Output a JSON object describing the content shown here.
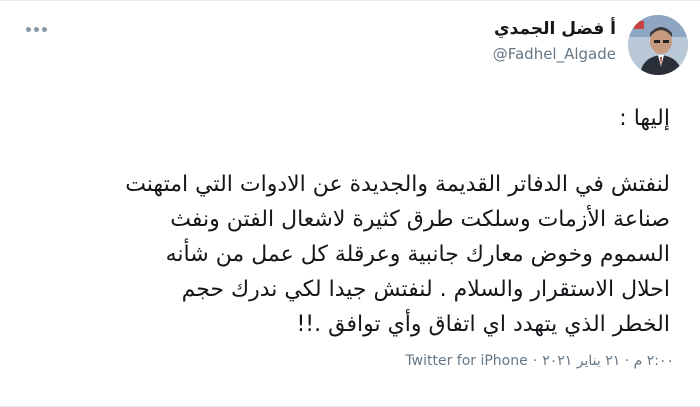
{
  "tweet": {
    "display_name": "أ فضل الجمدي",
    "handle": "@Fadhel_Algade",
    "avatar_icon": "profile-photo",
    "more_icon": "more-options-icon",
    "greeting": "إليها :",
    "lines": [
      "لنفتش في الدفاتر القديمة والجديدة عن الادوات التي امتهنت",
      "صناعة الأزمات وسلكت طرق كثيرة لاشعال الفتن ونفث",
      "السموم وخوض معارك جانبية  وعرقلة كل عمل من شأنه",
      "احلال الاستقرار والسلام . لنفتش جيدا لكي ندرك حجم",
      "الخطر الذي يتهدد اي اتفاق وأي توافق .!!"
    ],
    "timestamp": "٢:٠٠ م · ٢١ يناير ٢٠٢١",
    "separator": "·",
    "source": "Twitter for iPhone"
  },
  "colors": {
    "text": "#14171a",
    "secondary": "#657786",
    "border": "#e6ecf0"
  }
}
